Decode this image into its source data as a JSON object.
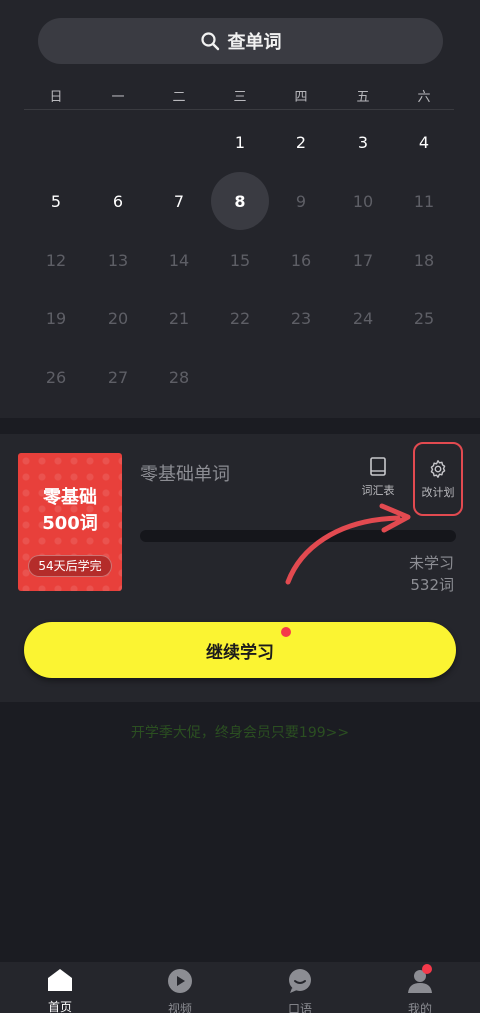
{
  "search": {
    "label": "查单词",
    "icon": "search-icon"
  },
  "calendar": {
    "weekdays": [
      "日",
      "一",
      "二",
      "三",
      "四",
      "五",
      "六"
    ],
    "today": "8",
    "days": [
      "1",
      "2",
      "3",
      "4",
      "5",
      "6",
      "7",
      "8",
      "9",
      "10",
      "11",
      "12",
      "13",
      "14",
      "15",
      "16",
      "17",
      "18",
      "19",
      "20",
      "21",
      "22",
      "23",
      "24",
      "25",
      "26",
      "27",
      "28"
    ]
  },
  "plan": {
    "book_title_line1": "零基础",
    "book_title_line2": "500词",
    "book_tag": "54天后学完",
    "title": "零基础单词",
    "vocab_label": "词汇表",
    "plan_label": "改计划",
    "progress": 0,
    "unlearned_label": "未学习",
    "unlearned_count": "532词"
  },
  "cta": {
    "label": "继续学习"
  },
  "promo": {
    "text": "开学季大促，终身会员只要199>>"
  },
  "tabs": [
    {
      "label": "首页",
      "icon": "home-icon"
    },
    {
      "label": "视频",
      "icon": "play-icon"
    },
    {
      "label": "口语",
      "icon": "chat-icon"
    },
    {
      "label": "我的",
      "icon": "profile-icon"
    }
  ],
  "colors": {
    "accent": "#fbf432",
    "book": "#e8403b",
    "badge": "#f5394a",
    "annotation": "#e24a50"
  }
}
